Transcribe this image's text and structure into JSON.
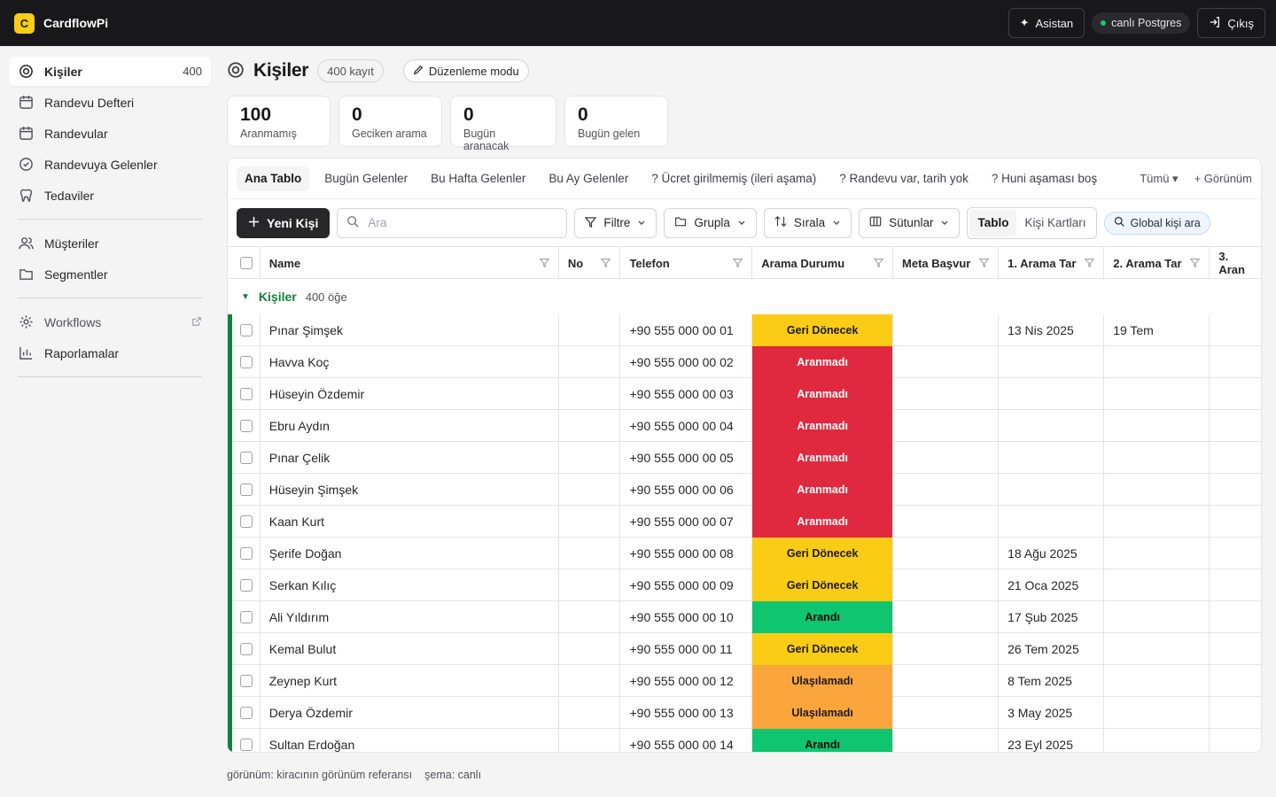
{
  "app": {
    "logo_letter": "C",
    "name": "CardflowPi"
  },
  "topbar": {
    "assistant": "Asistan",
    "db": "canlı Postgres",
    "logout": "Çıkış"
  },
  "sidebar": {
    "items": [
      {
        "label": "Kişiler",
        "count": "400",
        "icon": "target-icon",
        "active": true
      },
      {
        "label": "Randevu Defteri",
        "icon": "calendar-icon"
      },
      {
        "label": "Randevular",
        "icon": "calendar-icon"
      },
      {
        "label": "Randevuya Gelenler",
        "icon": "check-circle-icon"
      },
      {
        "label": "Tedaviler",
        "icon": "tooth-icon"
      }
    ],
    "group2": [
      {
        "label": "Müşteriler",
        "icon": "users-icon"
      },
      {
        "label": "Segmentler",
        "icon": "folder-icon"
      }
    ],
    "group3": [
      {
        "label": "Workflows",
        "icon": "gear-icon"
      },
      {
        "label": "Raporlamalar",
        "icon": "bar-chart-icon"
      }
    ]
  },
  "page": {
    "title": "Kişiler",
    "record_count": "400 kayıt",
    "edit_mode": "Düzenleme modu"
  },
  "stats": [
    {
      "value": "100",
      "label": "Aranmamış"
    },
    {
      "value": "0",
      "label": "Geciken arama"
    },
    {
      "value": "0",
      "label": "Bugün aranacak"
    },
    {
      "value": "0",
      "label": "Bugün gelen"
    }
  ],
  "tabs": [
    "Ana Tablo",
    "Bugün Gelenler",
    "Bu Hafta Gelenler",
    "Bu Ay Gelenler",
    "? Ücret girilmemiş (ileri aşama)",
    "? Randevu var, tarih yok",
    "? Huni aşaması boş"
  ],
  "tabs_right": {
    "all": "Tümü ▾",
    "view": "+ Görünüm"
  },
  "toolbar": {
    "new": "Yeni Kişi",
    "search_placeholder": "Ara",
    "filter": "Filtre",
    "group": "Grupla",
    "sort": "Sırala",
    "columns": "Sütunlar",
    "view_table": "Tablo",
    "view_cards": "Kişi Kartları",
    "global_search": "Global kişi ara"
  },
  "columns": [
    "Name",
    "No",
    "Telefon",
    "Arama Durumu",
    "Meta Başvur",
    "1. Arama Tar",
    "2. Arama Tar",
    "3. Aran"
  ],
  "group": {
    "name": "Kişiler",
    "count": "400 öğe"
  },
  "status_colors": {
    "Geri Dönecek": {
      "bg": "#facc15",
      "fg": "#1c1917"
    },
    "Aranmadı": {
      "bg": "#e0293f",
      "fg": "#ffffff"
    },
    "Arandı": {
      "bg": "#10c56f",
      "fg": "#0a0a0a"
    },
    "Ulaşılamadı": {
      "bg": "#fba63c",
      "fg": "#1c1917"
    }
  },
  "rows": [
    {
      "name": "Pınar Şimşek",
      "no": "",
      "tel": "+90 555 000 00 01",
      "status": "Geri Dönecek",
      "meta": "",
      "a1": "13 Nis 2025",
      "a2": "19 Tem",
      "a3": ""
    },
    {
      "name": "Havva Koç",
      "no": "",
      "tel": "+90 555 000 00 02",
      "status": "Aranmadı",
      "meta": "",
      "a1": "",
      "a2": "",
      "a3": ""
    },
    {
      "name": "Hüseyin Özdemir",
      "no": "",
      "tel": "+90 555 000 00 03",
      "status": "Aranmadı",
      "meta": "",
      "a1": "",
      "a2": "",
      "a3": ""
    },
    {
      "name": "Ebru Aydın",
      "no": "",
      "tel": "+90 555 000 00 04",
      "status": "Aranmadı",
      "meta": "",
      "a1": "",
      "a2": "",
      "a3": ""
    },
    {
      "name": "Pınar Çelik",
      "no": "",
      "tel": "+90 555 000 00 05",
      "status": "Aranmadı",
      "meta": "",
      "a1": "",
      "a2": "",
      "a3": ""
    },
    {
      "name": "Hüseyin Şimşek",
      "no": "",
      "tel": "+90 555 000 00 06",
      "status": "Aranmadı",
      "meta": "",
      "a1": "",
      "a2": "",
      "a3": ""
    },
    {
      "name": "Kaan Kurt",
      "no": "",
      "tel": "+90 555 000 00 07",
      "status": "Aranmadı",
      "meta": "",
      "a1": "",
      "a2": "",
      "a3": ""
    },
    {
      "name": "Şerife Doğan",
      "no": "",
      "tel": "+90 555 000 00 08",
      "status": "Geri Dönecek",
      "meta": "",
      "a1": "18 Ağu 2025",
      "a2": "",
      "a3": ""
    },
    {
      "name": "Serkan Kılıç",
      "no": "",
      "tel": "+90 555 000 00 09",
      "status": "Geri Dönecek",
      "meta": "",
      "a1": "21 Oca 2025",
      "a2": "",
      "a3": ""
    },
    {
      "name": "Ali Yıldırım",
      "no": "",
      "tel": "+90 555 000 00 10",
      "status": "Arandı",
      "meta": "",
      "a1": "17 Şub 2025",
      "a2": "",
      "a3": ""
    },
    {
      "name": "Kemal Bulut",
      "no": "",
      "tel": "+90 555 000 00 11",
      "status": "Geri Dönecek",
      "meta": "",
      "a1": "26 Tem 2025",
      "a2": "",
      "a3": ""
    },
    {
      "name": "Zeynep Kurt",
      "no": "",
      "tel": "+90 555 000 00 12",
      "status": "Ulaşılamadı",
      "meta": "",
      "a1": "8 Tem 2025",
      "a2": "",
      "a3": ""
    },
    {
      "name": "Derya Özdemir",
      "no": "",
      "tel": "+90 555 000 00 13",
      "status": "Ulaşılamadı",
      "meta": "",
      "a1": "3 May 2025",
      "a2": "",
      "a3": ""
    },
    {
      "name": "Sultan Erdoğan",
      "no": "",
      "tel": "+90 555 000 00 14",
      "status": "Arandı",
      "meta": "",
      "a1": "23 Eyl 2025",
      "a2": "",
      "a3": ""
    }
  ],
  "footer": {
    "view_ref": "görünüm: kiracının görünüm referansı",
    "schema": "şema: canlı"
  }
}
